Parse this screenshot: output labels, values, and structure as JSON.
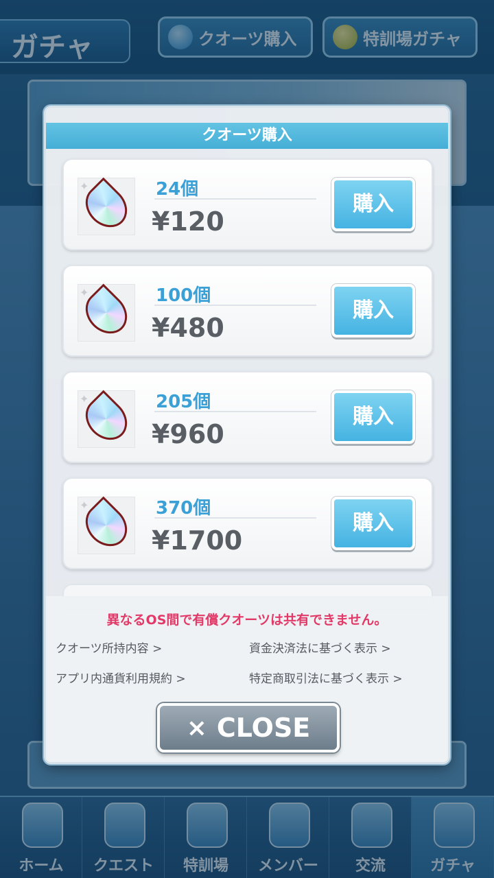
{
  "app": {
    "title": "ガチャ",
    "top_buttons": [
      {
        "label": "クオーツ購入",
        "icon": "quartz-icon"
      },
      {
        "label": "特訓場ガチャ",
        "icon": "coin-icon"
      }
    ]
  },
  "modal": {
    "title": "クオーツ購入",
    "items": [
      {
        "quantity": "24個",
        "price": "¥120",
        "button": "購入"
      },
      {
        "quantity": "100個",
        "price": "¥480",
        "button": "購入"
      },
      {
        "quantity": "205個",
        "price": "¥960",
        "button": "購入"
      },
      {
        "quantity": "370個",
        "price": "¥1700",
        "button": "購入"
      }
    ],
    "warning": "異なるOS間で有償クオーツは共有できません。",
    "links": [
      "クオーツ所持内容 >",
      "資金決済法に基づく表示 >",
      "アプリ内通貨利用規約 >",
      "特定商取引法に基づく表示 >"
    ],
    "close_icon": "×",
    "close_label": "CLOSE"
  },
  "bottom_nav": {
    "items": [
      {
        "label": "ホーム",
        "icon": "school-icon"
      },
      {
        "label": "クエスト",
        "icon": "monster-icon"
      },
      {
        "label": "特訓場",
        "icon": "crossed-swords-icon"
      },
      {
        "label": "メンバー",
        "icon": "cat-girl-icon"
      },
      {
        "label": "交流",
        "icon": "outfit-icon"
      },
      {
        "label": "ガチャ",
        "icon": "curtain-icon"
      }
    ],
    "active_index": 5
  },
  "colors": {
    "accent": "#45b3e2",
    "warning": "#e23a68",
    "quantity": "#3aa0d6"
  }
}
